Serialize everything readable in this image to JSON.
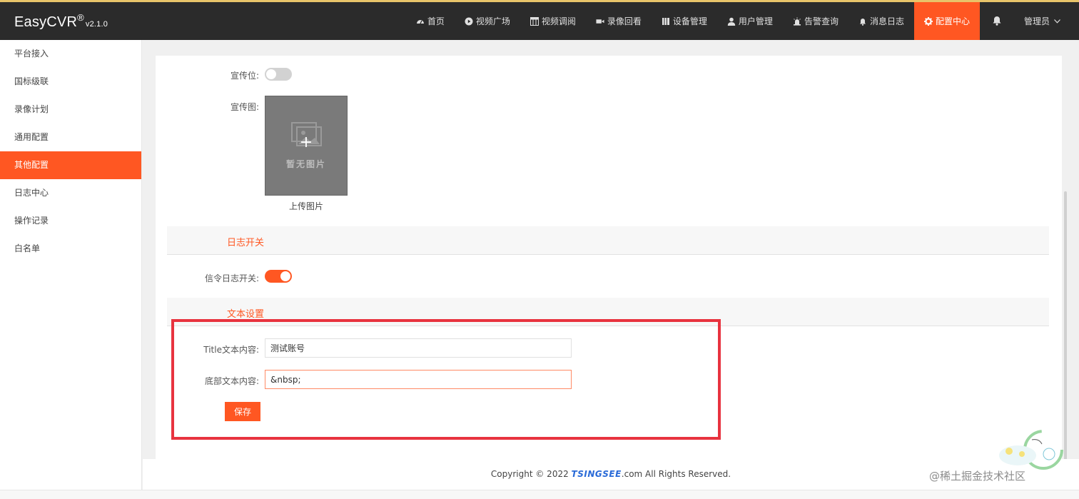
{
  "app": {
    "name": "EasyCVR",
    "registered": "®",
    "version": "v2.1.0"
  },
  "nav": {
    "items": [
      {
        "label": "首页",
        "icon": "dashboard-icon"
      },
      {
        "label": "视频广场",
        "icon": "play-circle-icon"
      },
      {
        "label": "视频调阅",
        "icon": "grid-icon"
      },
      {
        "label": "录像回看",
        "icon": "video-camera-icon"
      },
      {
        "label": "设备管理",
        "icon": "device-icon"
      },
      {
        "label": "用户管理",
        "icon": "user-icon"
      },
      {
        "label": "告警查询",
        "icon": "alarm-icon"
      },
      {
        "label": "消息日志",
        "icon": "bell-icon"
      },
      {
        "label": "配置中心",
        "icon": "gear-icon",
        "active": true
      }
    ],
    "notification_icon": "bell-icon",
    "user_label": "管理员",
    "user_caret": "chevron-down-icon",
    "accent": "#ff5722"
  },
  "sidebar": {
    "items": [
      {
        "label": "平台接入"
      },
      {
        "label": "国标级联"
      },
      {
        "label": "录像计划"
      },
      {
        "label": "通用配置"
      },
      {
        "label": "其他配置",
        "active": true
      },
      {
        "label": "日志中心"
      },
      {
        "label": "操作记录"
      },
      {
        "label": "白名单"
      }
    ]
  },
  "form": {
    "promo_label": "宣传位:",
    "promo_enabled": false,
    "promo_image_label": "宣传图:",
    "promo_image_placeholder": "暂无图片",
    "upload_label": "上传图片",
    "log_section_title": "日志开关",
    "signal_log_label": "信令日志开关:",
    "signal_log_enabled": true,
    "text_section_title": "文本设置",
    "title_text_label": "Title文本内容:",
    "title_text_value": "测试账号",
    "footer_text_label": "底部文本内容:",
    "footer_text_value": "&nbsp;",
    "save_label": "保存"
  },
  "footer": {
    "prefix": "Copyright © 2022 ",
    "brand": "TSINGSEE",
    "suffix": ".com All Rights Reserved."
  },
  "watermark": "@稀土掘金技术社区",
  "colors": {
    "topbar_bg": "#2b2b2b",
    "accent": "#ff5722",
    "highlight_border": "#e8333f"
  }
}
